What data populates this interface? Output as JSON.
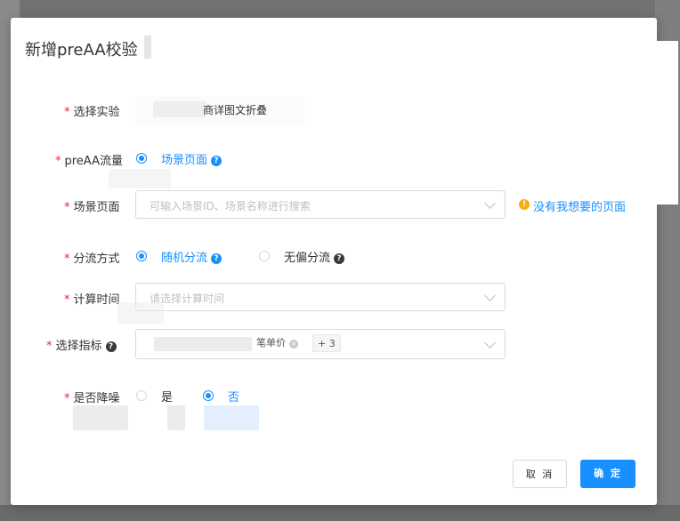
{
  "modal": {
    "title": "新增preAA校验"
  },
  "form": {
    "experiment": {
      "label": "选择实验",
      "value": "商详图文折叠"
    },
    "traffic": {
      "label": "preAA流量",
      "option": "场景页面"
    },
    "scene_page": {
      "label": "场景页面",
      "placeholder": "可输入场景ID、场景名称进行搜索",
      "missing_link": "没有我想要的页面"
    },
    "split_method": {
      "label": "分流方式",
      "options": [
        "随机分流",
        "无偏分流"
      ]
    },
    "calc_time": {
      "label": "计算时间",
      "placeholder": "请选择计算时间"
    },
    "metrics": {
      "label": "选择指标",
      "tag": "笔单价",
      "more": "+ 3"
    },
    "denoise": {
      "label": "是否降噪",
      "options": [
        "是",
        "否"
      ]
    }
  },
  "footer": {
    "cancel_label": "取 消",
    "ok_label": "确 定"
  },
  "colors": {
    "primary": "#1890ff",
    "required": "#f5222d",
    "warning": "#faad14"
  },
  "icons": {
    "help": "question-circle-icon",
    "warning": "exclamation-circle-icon",
    "dropdown": "chevron-down-icon",
    "tag_close": "close-circle-icon"
  }
}
